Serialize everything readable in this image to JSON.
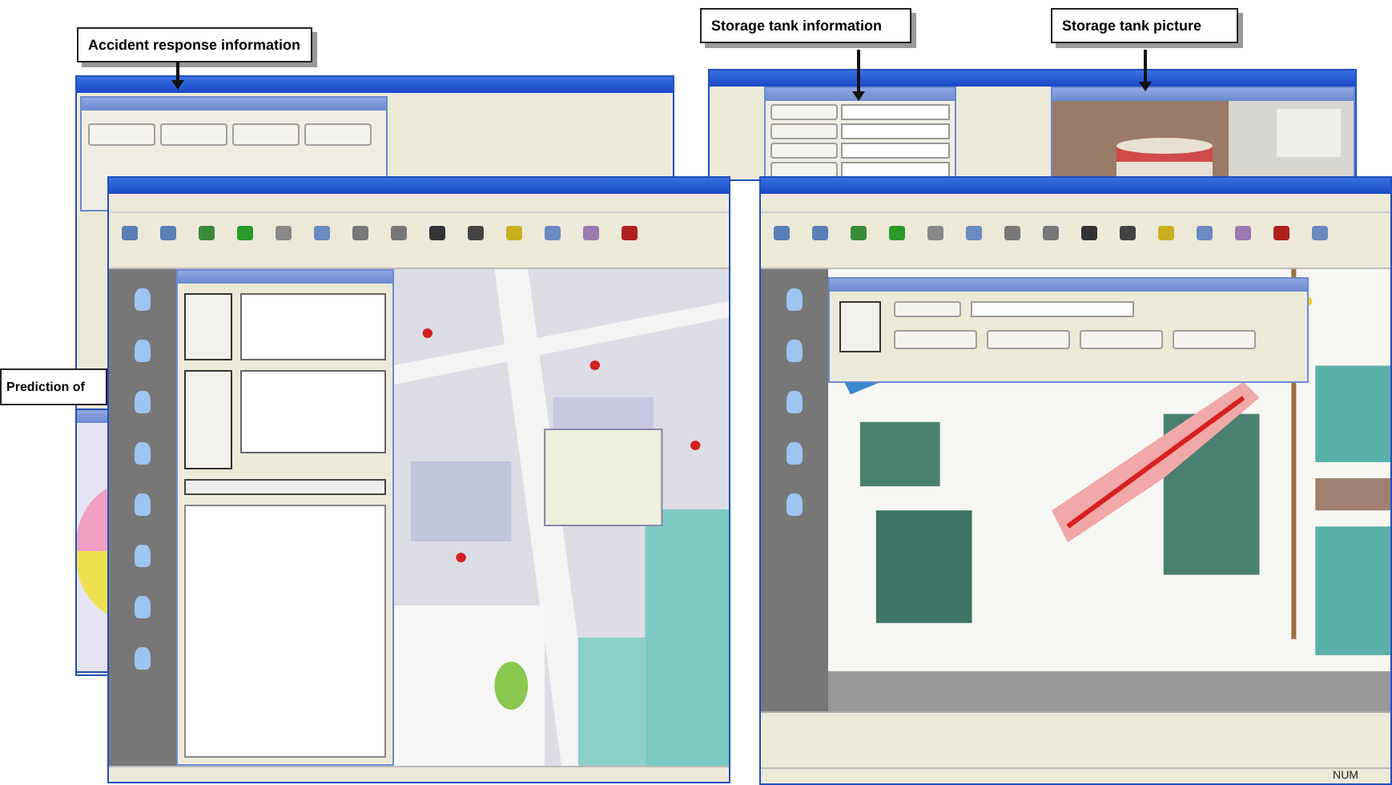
{
  "callouts": [
    {
      "label": "Accident response information"
    },
    {
      "label": "Storage tank information"
    },
    {
      "label": "Storage tank picture"
    },
    {
      "label": "Prediction of"
    }
  ],
  "status_bar": {
    "indicator": "NUM"
  }
}
